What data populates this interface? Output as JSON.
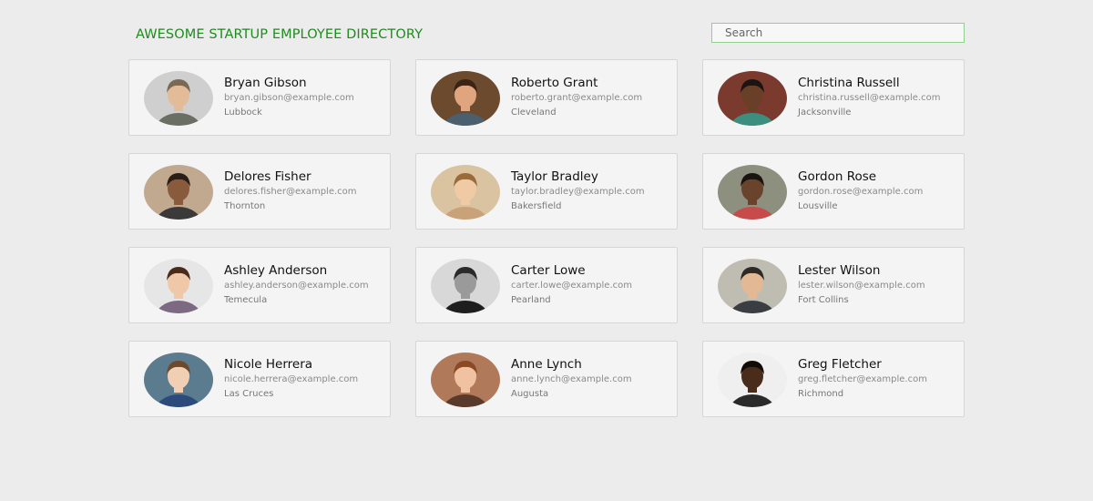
{
  "header": {
    "title": "AWESOME STARTUP EMPLOYEE DIRECTORY",
    "search_placeholder": "Search"
  },
  "employees": [
    {
      "name": "Bryan Gibson",
      "email": "bryan.gibson@example.com",
      "city": "Lubbock",
      "avatar": {
        "bg": "#cfcfcf",
        "skin": "#e2bb98",
        "hair": "#7a6a55",
        "shirt": "#6b6e62"
      }
    },
    {
      "name": "Roberto Grant",
      "email": "roberto.grant@example.com",
      "city": "Cleveland",
      "avatar": {
        "bg": "#6b4a2e",
        "skin": "#e0a57e",
        "hair": "#3a2416",
        "shirt": "#4c5f6e"
      }
    },
    {
      "name": "Christina Russell",
      "email": "christina.russell@example.com",
      "city": "Jacksonville",
      "avatar": {
        "bg": "#7a3b2e",
        "skin": "#6a3f28",
        "hair": "#1c1412",
        "shirt": "#3c8f7e"
      }
    },
    {
      "name": "Delores Fisher",
      "email": "delores.fisher@example.com",
      "city": "Thornton",
      "avatar": {
        "bg": "#c0a98e",
        "skin": "#8a5a3c",
        "hair": "#2a1e16",
        "shirt": "#3a3a3a"
      }
    },
    {
      "name": "Taylor Bradley",
      "email": "taylor.bradley@example.com",
      "city": "Bakersfield",
      "avatar": {
        "bg": "#d9c3a0",
        "skin": "#f0c9a5",
        "hair": "#9a6b3a",
        "shirt": "#caa27a"
      }
    },
    {
      "name": "Gordon Rose",
      "email": "gordon.rose@example.com",
      "city": "Lousville",
      "avatar": {
        "bg": "#8d8f7f",
        "skin": "#6a432c",
        "hair": "#1a1410",
        "shirt": "#c74b4b"
      }
    },
    {
      "name": "Ashley Anderson",
      "email": "ashley.anderson@example.com",
      "city": "Temecula",
      "avatar": {
        "bg": "#e6e6e6",
        "skin": "#efc8aa",
        "hair": "#4a2a18",
        "shirt": "#7c6a82"
      }
    },
    {
      "name": "Carter Lowe",
      "email": "carter.lowe@example.com",
      "city": "Pearland",
      "avatar": {
        "bg": "#d8d8d8",
        "skin": "#9a9a9a",
        "hair": "#2a2a2a",
        "shirt": "#1e1e1e"
      }
    },
    {
      "name": "Lester Wilson",
      "email": "lester.wilson@example.com",
      "city": "Fort Collins",
      "avatar": {
        "bg": "#bfbcb2",
        "skin": "#e2b993",
        "hair": "#2e2a26",
        "shirt": "#3a3d42"
      }
    },
    {
      "name": "Nicole Herrera",
      "email": "nicole.herrera@example.com",
      "city": "Las Cruces",
      "avatar": {
        "bg": "#5b7b8f",
        "skin": "#f1cfb4",
        "hair": "#6e4a2a",
        "shirt": "#2d4a7c"
      }
    },
    {
      "name": "Anne Lynch",
      "email": "anne.lynch@example.com",
      "city": "Augusta",
      "avatar": {
        "bg": "#b07a5a",
        "skin": "#f0c2a2",
        "hair": "#8a4a26",
        "shirt": "#5a3a2a"
      }
    },
    {
      "name": "Greg Fletcher",
      "email": "greg.fletcher@example.com",
      "city": "Richmond",
      "avatar": {
        "bg": "#efefef",
        "skin": "#4a2c1c",
        "hair": "#120c08",
        "shirt": "#2a2a2a"
      }
    }
  ]
}
